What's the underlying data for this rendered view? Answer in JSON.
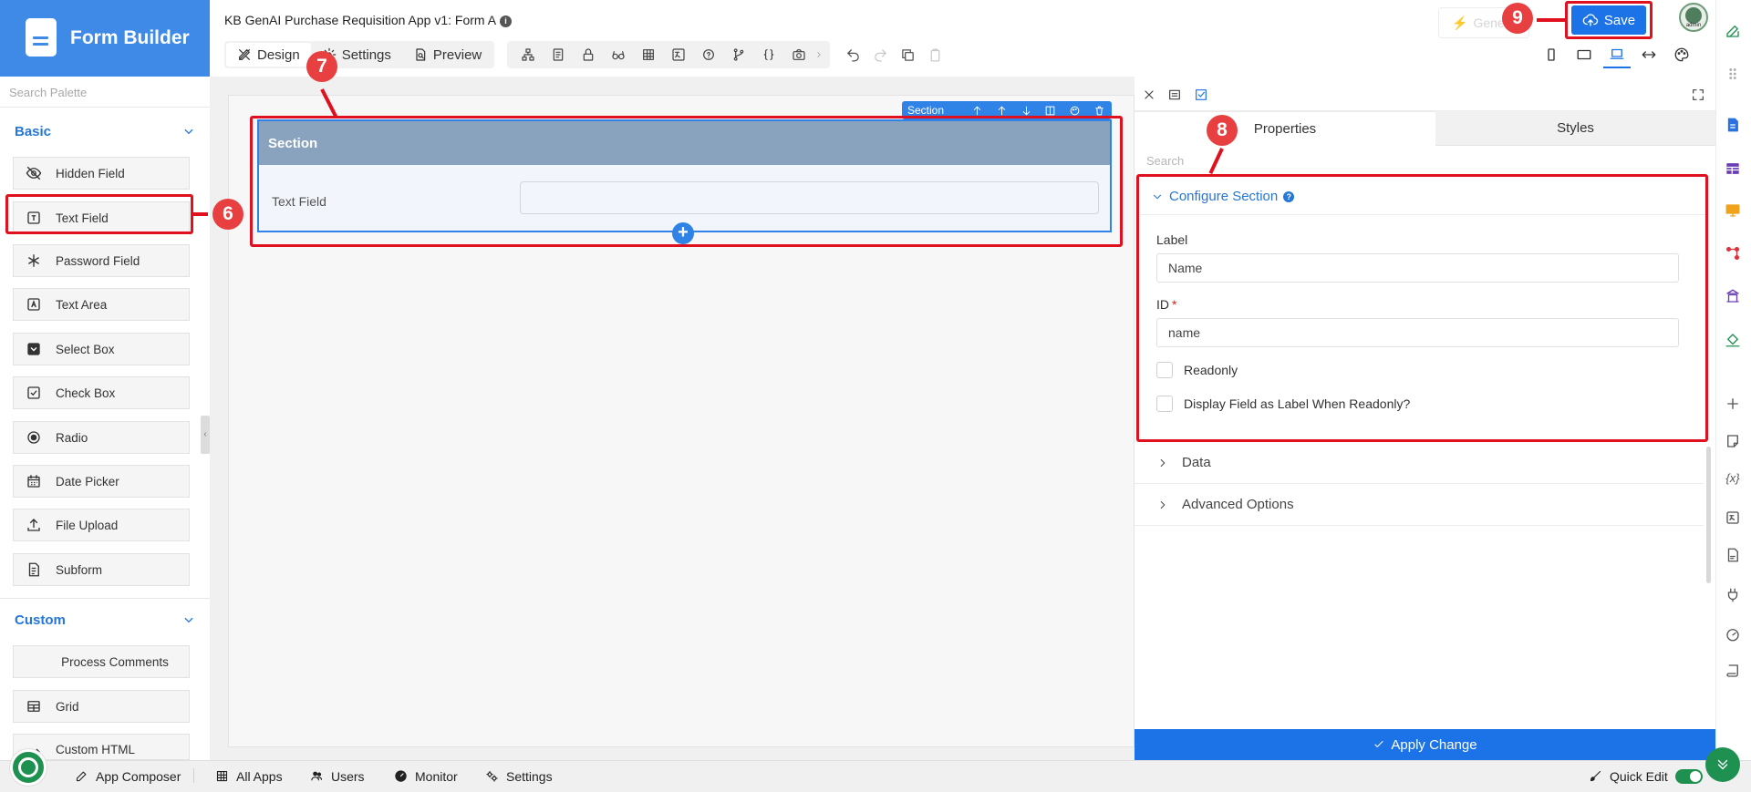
{
  "sidebar": {
    "brand": "Form Builder",
    "search_placeholder": "Search Palette",
    "basic_label": "Basic",
    "custom_label": "Custom",
    "basic_items": [
      "Hidden Field",
      "Text Field",
      "Password Field",
      "Text Area",
      "Select Box",
      "Check Box",
      "Radio",
      "Date Picker",
      "File Upload",
      "Subform"
    ],
    "custom_items": [
      "Process Comments",
      "Grid",
      "Custom HTML"
    ]
  },
  "header": {
    "app_title": "KB GenAI Purchase Requisition App v1: Form A",
    "tabs": [
      "Design",
      "Settings",
      "Preview"
    ],
    "generate_label": "Gene",
    "save_label": "Save",
    "avatar_label": "admin"
  },
  "canvas": {
    "section_toolbar_label": "Section",
    "section_title": "Section",
    "field_label": "Text Field"
  },
  "properties": {
    "tab_properties": "Properties",
    "tab_styles": "Styles",
    "search_placeholder": "Search",
    "configure_title": "Configure Section",
    "label_field": "Label",
    "label_value": "Name",
    "id_field": "ID",
    "id_required": "*",
    "id_value": "name",
    "readonly_label": "Readonly",
    "display_label": "Display Field as Label When Readonly?",
    "data_label": "Data",
    "advanced_label": "Advanced Options",
    "apply_label": "Apply Change"
  },
  "bottom": {
    "items": [
      "App Composer",
      "All Apps",
      "Users",
      "Monitor",
      "Settings"
    ],
    "quick_edit": "Quick Edit"
  },
  "annotations": [
    "6",
    "7",
    "8",
    "9"
  ],
  "colors": {
    "accent": "#1c73e8",
    "brand": "#3f8ae6",
    "highlight": "#e0101e",
    "badge": "#e83f40",
    "section_header": "#89a3bf",
    "green": "#1e9150"
  }
}
